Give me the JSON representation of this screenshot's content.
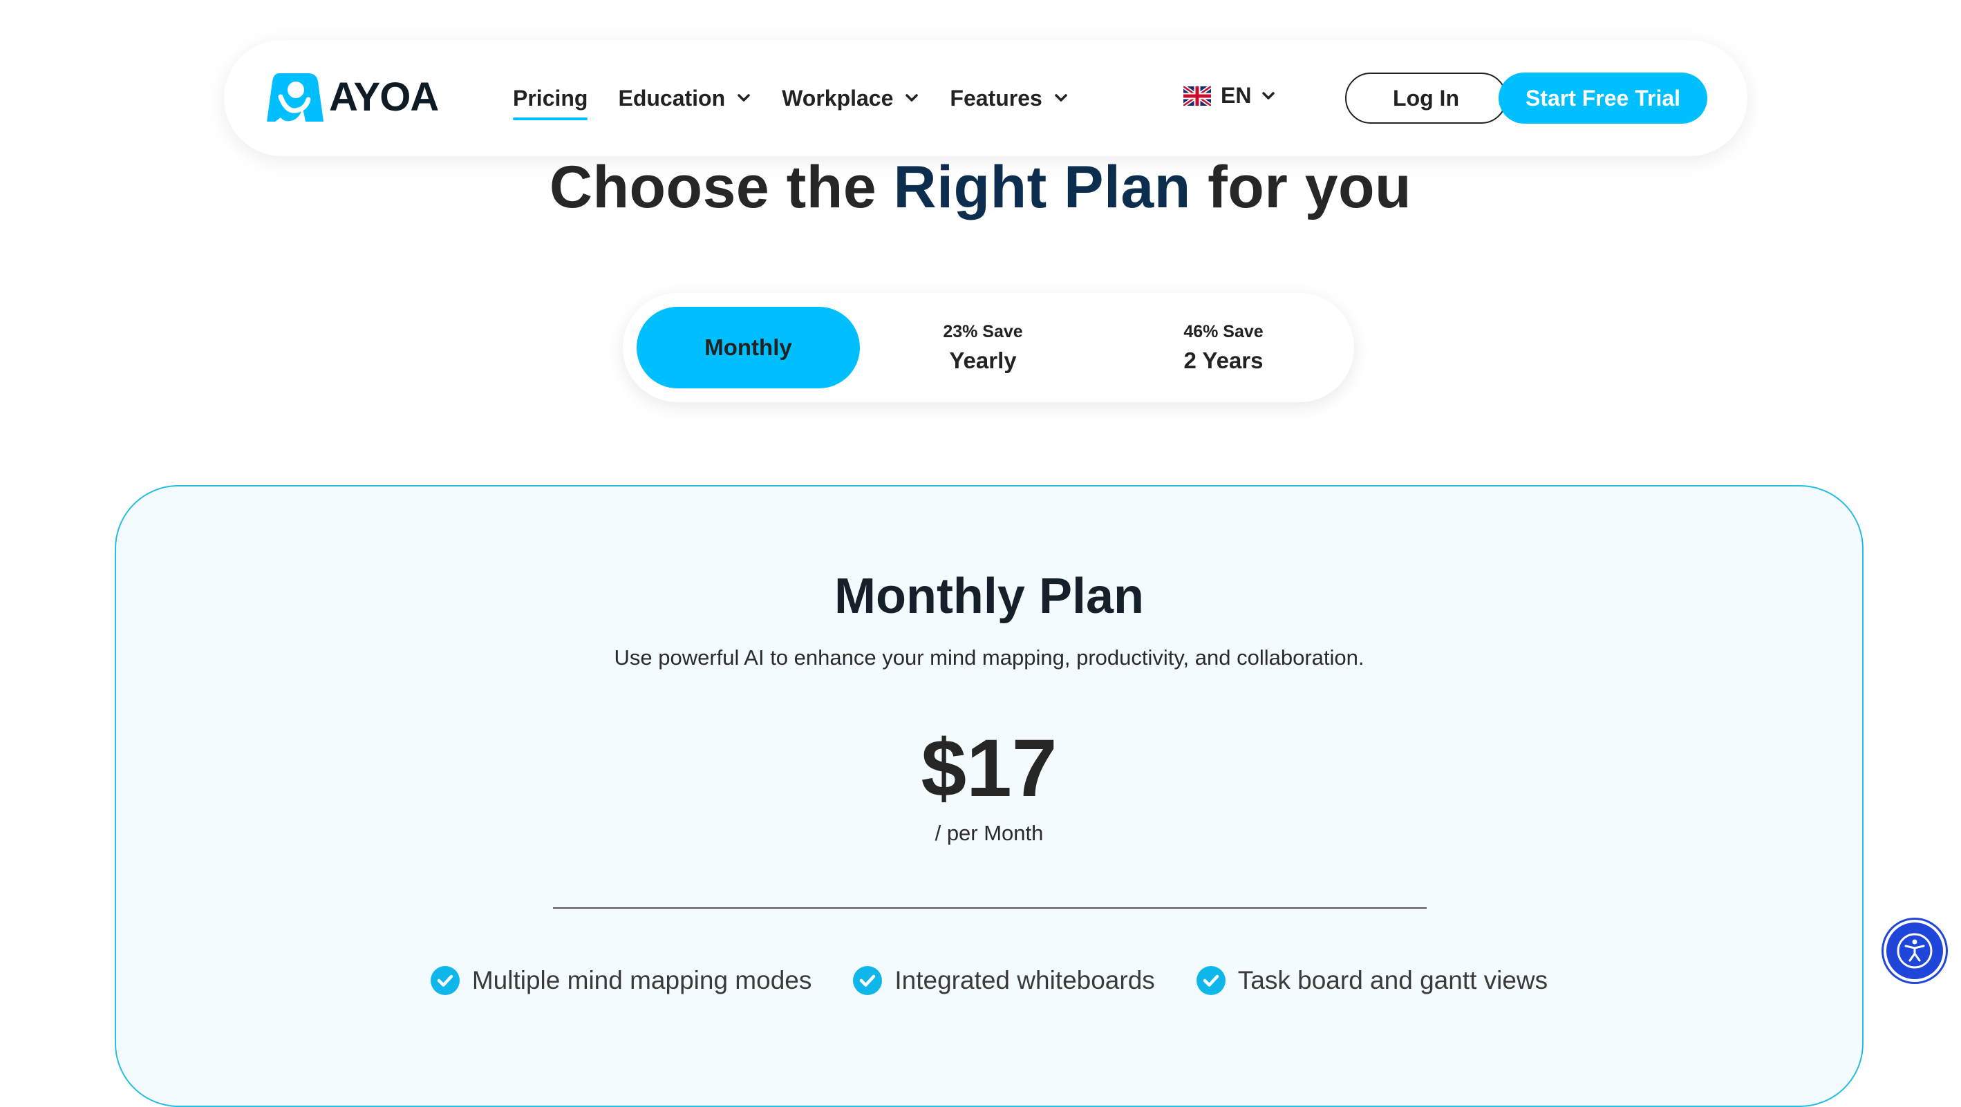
{
  "brand": {
    "name": "AYOA",
    "icon": "ayoa-logo-icon",
    "color": "#00bfff"
  },
  "nav": {
    "items": [
      {
        "label": "Pricing",
        "active": true
      },
      {
        "label": "Education",
        "dropdown": true
      },
      {
        "label": "Workplace",
        "dropdown": true
      },
      {
        "label": "Features",
        "dropdown": true
      }
    ],
    "language": "EN",
    "login_label": "Log In",
    "trial_label": "Start Free Trial"
  },
  "heading": {
    "part1": "Choose the ",
    "highlight": "Right Plan",
    "part2": " for you"
  },
  "billing_toggle": {
    "options": [
      {
        "label": "Monthly",
        "save": "",
        "selected": true
      },
      {
        "label": "Yearly",
        "save": "23% Save",
        "selected": false
      },
      {
        "label": "2 Years",
        "save": "46% Save",
        "selected": false
      }
    ]
  },
  "plan": {
    "title": "Monthly Plan",
    "description": "Use powerful AI to enhance your mind mapping, productivity, and collaboration.",
    "price": "$17",
    "period": "/ per Month",
    "features": [
      "Multiple mind mapping modes",
      "Integrated whiteboards",
      "Task board and gantt views"
    ]
  },
  "colors": {
    "accent": "#00bfff",
    "heading_highlight": "#0c2d4d",
    "card_border": "#27bde0",
    "accessibility": "#1f46d8"
  }
}
